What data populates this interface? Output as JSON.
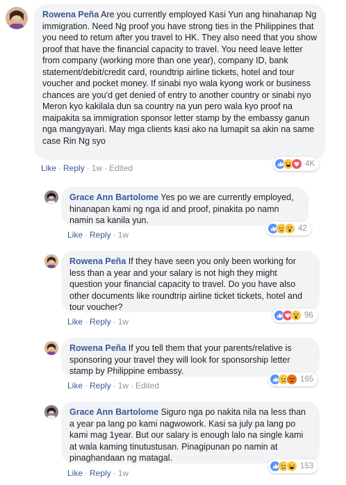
{
  "comments": [
    {
      "author": "Rowena Peña",
      "text": " Are you currently employed Kasi Yun ang hinahanap Ng immigration. Need Ng proof you have strong ties in the Philippines that you need to return after you travel to HK. They also need that you show proof that have the financial capacity to travel. You need leave letter from company (working more than one year), company ID, bank statement/debit/credit card, roundtrip airline tickets, hotel and tour voucher and pocket money. If sinabi nyo wala kyong work or business chances are you'd get denied of entry to another country or sinabi nyo Meron kyo kakilala dun sa country na yun pero wala kyo proof na maipakita sa immigration sponsor letter stamp by the embassy ganun nga mangyayari. May mga clients kasi ako na lumapit sa akin na same case Rin Ng syo",
      "like": "Like",
      "reply": "Reply",
      "time": "1w",
      "edited": "Edited",
      "reaction_count": "4K",
      "reactions": [
        "like",
        "haha",
        "love"
      ]
    },
    {
      "author": "Grace Ann Bartolome",
      "text": " Yes po we are currently employed, hinanapan kami ng nga id and proof, pinakita po namn namin sa kanila yun.",
      "like": "Like",
      "reply": "Reply",
      "time": "1w",
      "edited": "",
      "reaction_count": "42",
      "reactions": [
        "like",
        "sad",
        "wow"
      ]
    },
    {
      "author": "Rowena Peña",
      "text": " If they have seen you only been working for less than a year and your salary is not high they might question your financial capacity to travel. Do you have also other documents like roundtrip airline ticket tickets, hotel and tour voucher?",
      "like": "Like",
      "reply": "Reply",
      "time": "1w",
      "edited": "",
      "reaction_count": "96",
      "reactions": [
        "like",
        "love",
        "wow"
      ]
    },
    {
      "author": "Rowena Peña",
      "text": " If you tell them that your parents/relative is sponsoring your travel they will look for sponsorship letter stamp by Philippine embassy.",
      "like": "Like",
      "reply": "Reply",
      "time": "1w",
      "edited": "Edited",
      "reaction_count": "165",
      "reactions": [
        "like",
        "sad",
        "angry"
      ]
    },
    {
      "author": "Grace Ann Bartolome",
      "text": " Siguro nga po nakita nila na less than a year pa lang po kami nagwowork. Kasi sa july pa lang po kami mag 1year. But our salary is enough lalo na single kami at wala kaming tinutustusan. Pinagipunan po namin at pinaghandaan ng matagal.",
      "like": "Like",
      "reply": "Reply",
      "time": "1w",
      "edited": "",
      "reaction_count": "153",
      "reactions": [
        "like",
        "sad",
        "haha"
      ]
    }
  ],
  "colors": {
    "author": "#385898",
    "bubble": "#f2f3f5",
    "like": "#5890ff",
    "love": "#f25268",
    "yellow": "#f7c748",
    "angry": "#e9710f"
  }
}
